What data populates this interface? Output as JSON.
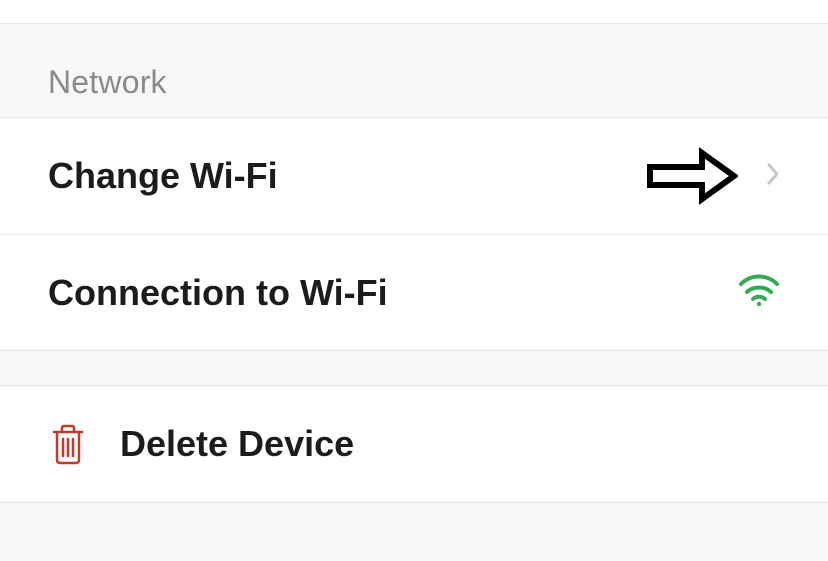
{
  "section_header": "Network",
  "rows": {
    "change_wifi": {
      "label": "Change Wi-Fi"
    },
    "connection": {
      "label": "Connection to Wi-Fi"
    }
  },
  "delete": {
    "label": "Delete Device"
  }
}
